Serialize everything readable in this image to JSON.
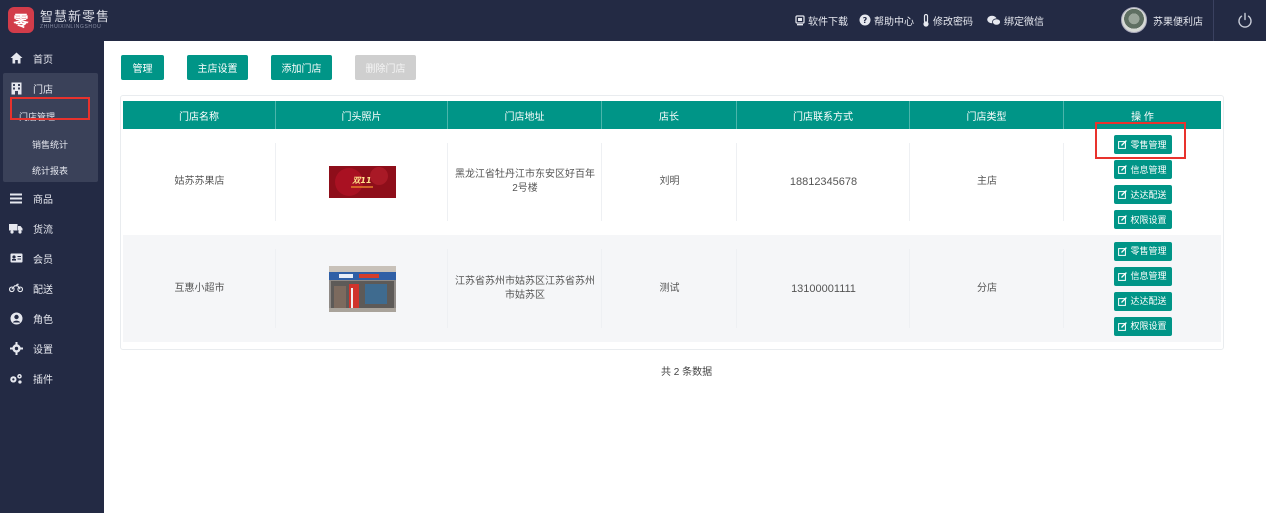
{
  "header": {
    "logo_text": "智慧新零售",
    "logo_sub": "ZHIHUIXINLINGSHOU",
    "logo_mark": "零",
    "links": [
      {
        "icon": "download-icon",
        "label": "软件下载"
      },
      {
        "icon": "help-icon",
        "label": "帮助中心"
      },
      {
        "icon": "thermometer-icon",
        "label": "修改密码"
      },
      {
        "icon": "wechat-icon",
        "label": "绑定微信"
      }
    ],
    "user_name": "苏果便利店"
  },
  "sidebar": {
    "items": [
      {
        "icon": "home-icon",
        "label": "首页"
      },
      {
        "icon": "building-icon",
        "label": "门店"
      },
      {
        "icon": "list-icon",
        "label": "商品"
      },
      {
        "icon": "truck-icon",
        "label": "货流"
      },
      {
        "icon": "member-card-icon",
        "label": "会员"
      },
      {
        "icon": "motorcycle-icon",
        "label": "配送"
      },
      {
        "icon": "user-circle-icon",
        "label": "角色"
      },
      {
        "icon": "gear-icon",
        "label": "设置"
      },
      {
        "icon": "gears-icon",
        "label": "插件"
      }
    ],
    "sub_items": [
      {
        "label": "门店管理"
      },
      {
        "label": "销售统计"
      },
      {
        "label": "统计报表"
      }
    ]
  },
  "toolbar": {
    "manage": "管理",
    "main_store_settings": "主店设置",
    "add_store": "添加门店",
    "delete_store": "删除门店"
  },
  "table": {
    "columns": [
      "门店名称",
      "门头照片",
      "门店地址",
      "店长",
      "门店联系方式",
      "门店类型",
      "操 作"
    ],
    "rows": [
      {
        "name": "姑苏苏果店",
        "address": "黑龙江省牡丹江市东安区好百年2号楼",
        "manager": "刘明",
        "phone": "18812345678",
        "type": "主店",
        "photo_text": "双11"
      },
      {
        "name": "互惠小超市",
        "address": "江苏省苏州市姑苏区江苏省苏州市姑苏区",
        "manager": "测试",
        "phone": "13100001111",
        "type": "分店",
        "photo_text": ""
      }
    ],
    "actions": [
      "零售管理",
      "信息管理",
      "达达配送",
      "权限设置"
    ]
  },
  "footer": {
    "total_text": "共 2 条数据"
  },
  "colors": {
    "primary": "#009587",
    "sidebar_bg": "#232a44",
    "highlight": "#e8322d"
  }
}
